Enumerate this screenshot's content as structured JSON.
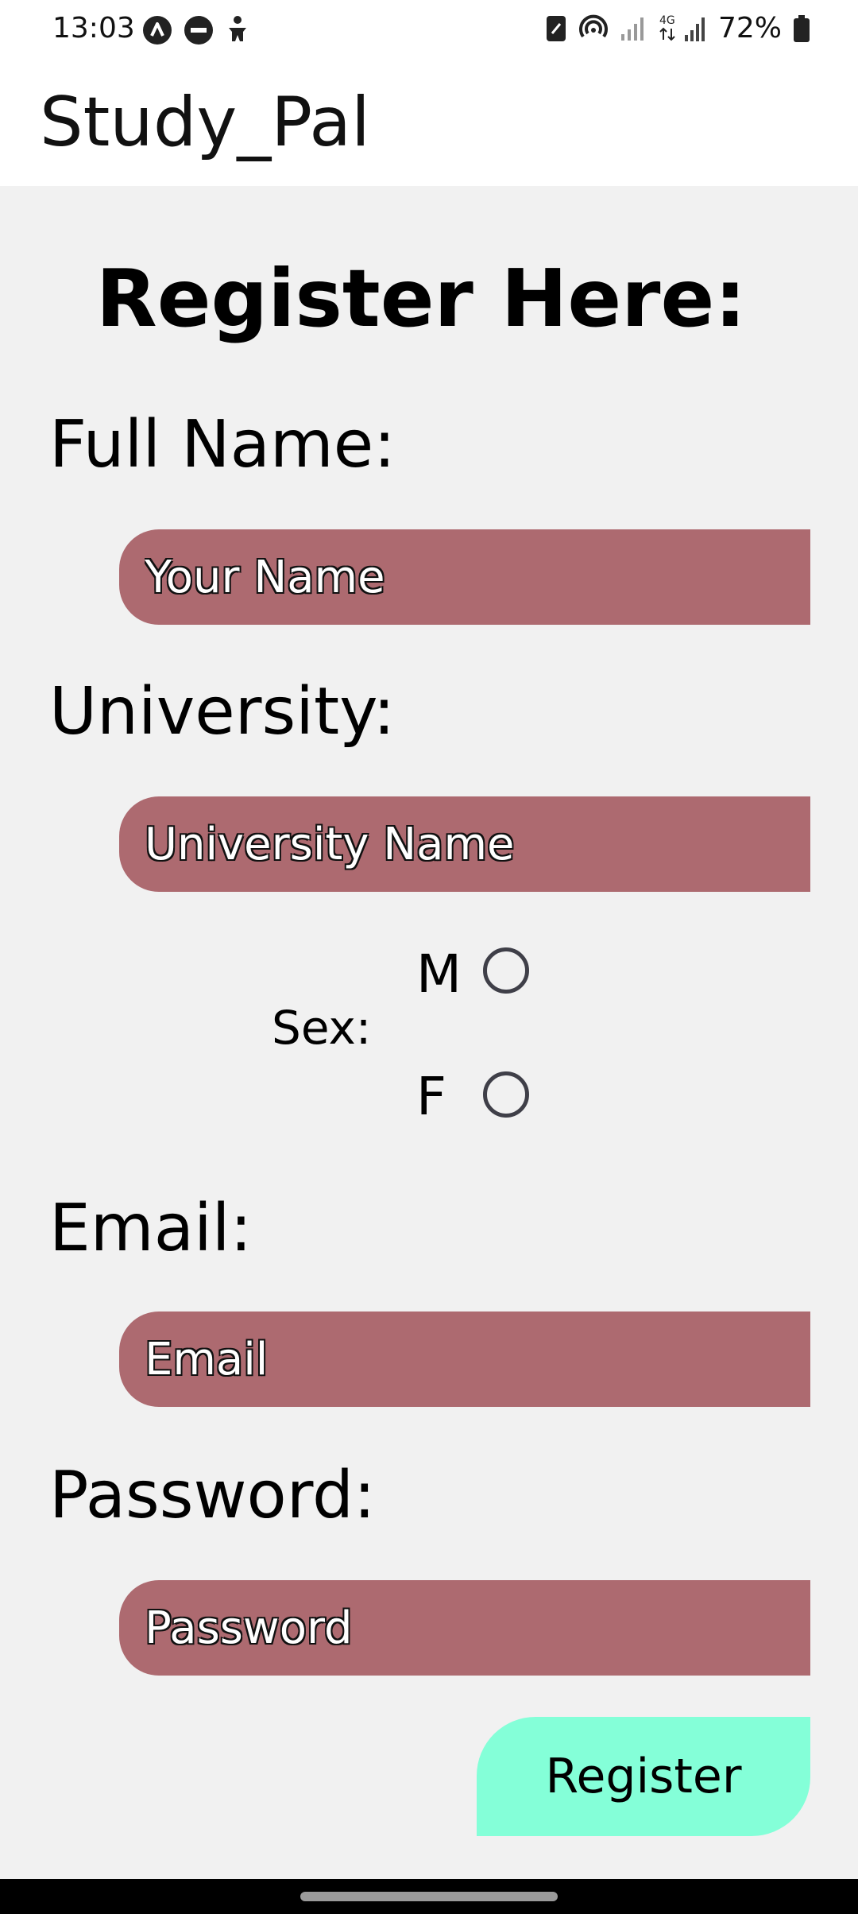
{
  "status_bar": {
    "time": "13:03",
    "battery": "72%",
    "network_type": "4G",
    "left_icons": [
      "app-indicator-icon",
      "do-not-disturb-icon",
      "accessibility-icon"
    ],
    "right_icons": [
      "nfc-icon",
      "hotspot-icon",
      "signal-icon",
      "signal-4g-icon",
      "battery-icon"
    ]
  },
  "app_bar": {
    "title": "Study_Pal"
  },
  "form": {
    "heading": "Register Here:",
    "full_name": {
      "label": "Full Name:",
      "placeholder": "Your Name",
      "value": ""
    },
    "university": {
      "label": "University:",
      "placeholder": "University Name",
      "value": ""
    },
    "sex": {
      "label": "Sex:",
      "options": [
        {
          "label": "M",
          "selected": false
        },
        {
          "label": "F",
          "selected": false
        }
      ]
    },
    "email": {
      "label": "Email:",
      "placeholder": "Email",
      "value": ""
    },
    "password": {
      "label": "Password:",
      "placeholder": "Password",
      "value": ""
    },
    "register_label": "Register"
  },
  "colors": {
    "input_background": "#ad6a70",
    "button_background": "#84ffd8",
    "page_background": "#f1f1f1"
  }
}
